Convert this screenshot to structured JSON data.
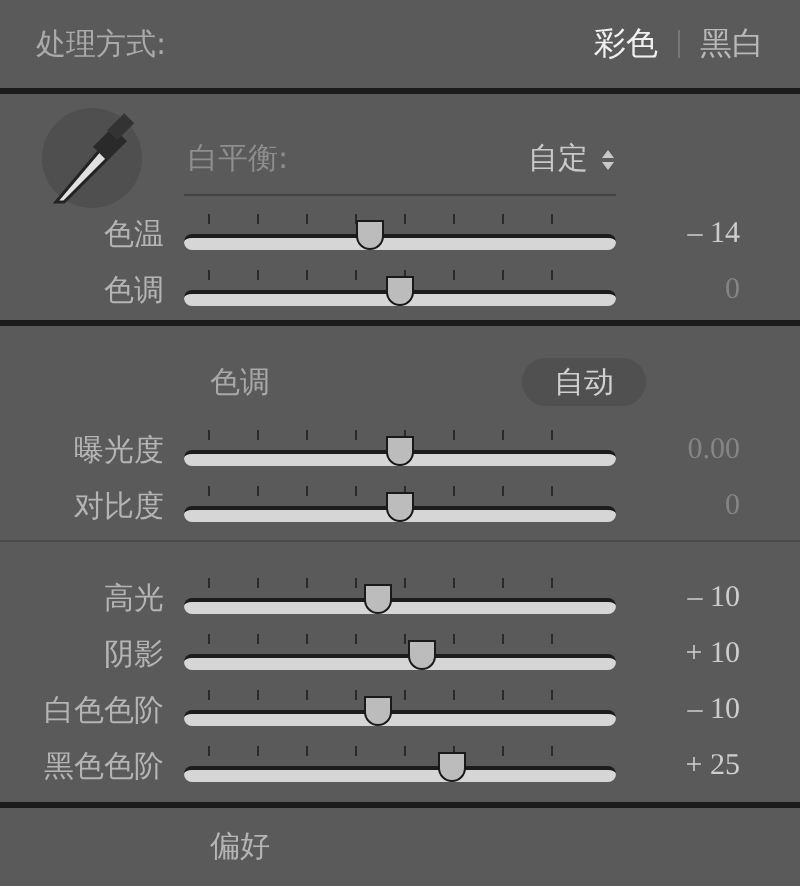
{
  "processing": {
    "label": "处理方式:",
    "options": [
      {
        "label": "彩色",
        "selected": true
      },
      {
        "label": "黑白",
        "selected": false
      }
    ]
  },
  "white_balance": {
    "label": "白平衡:",
    "value": "自定"
  },
  "wb_sliders": [
    {
      "label": "色温",
      "level": 0.43,
      "reading": "– 14",
      "dimmed": false
    },
    {
      "label": "色调",
      "level": 0.5,
      "reading": "0",
      "dimmed": true
    }
  ],
  "tone": {
    "label": "色调",
    "auto_button": "自动"
  },
  "tone_sliders": [
    {
      "label": "曝光度",
      "level": 0.5,
      "reading": "0.00",
      "dimmed": true
    },
    {
      "label": "对比度",
      "level": 0.5,
      "reading": "0",
      "dimmed": true
    }
  ],
  "presence_sliders": [
    {
      "label": "高光",
      "level": 0.45,
      "reading": "– 10",
      "dimmed": false
    },
    {
      "label": "阴影",
      "level": 0.55,
      "reading": "+ 10",
      "dimmed": false
    },
    {
      "label": "白色色阶",
      "level": 0.45,
      "reading": "– 10",
      "dimmed": false
    },
    {
      "label": "黑色色阶",
      "level": 0.62,
      "reading": "+ 25",
      "dimmed": false
    }
  ],
  "footer_label": "偏好"
}
